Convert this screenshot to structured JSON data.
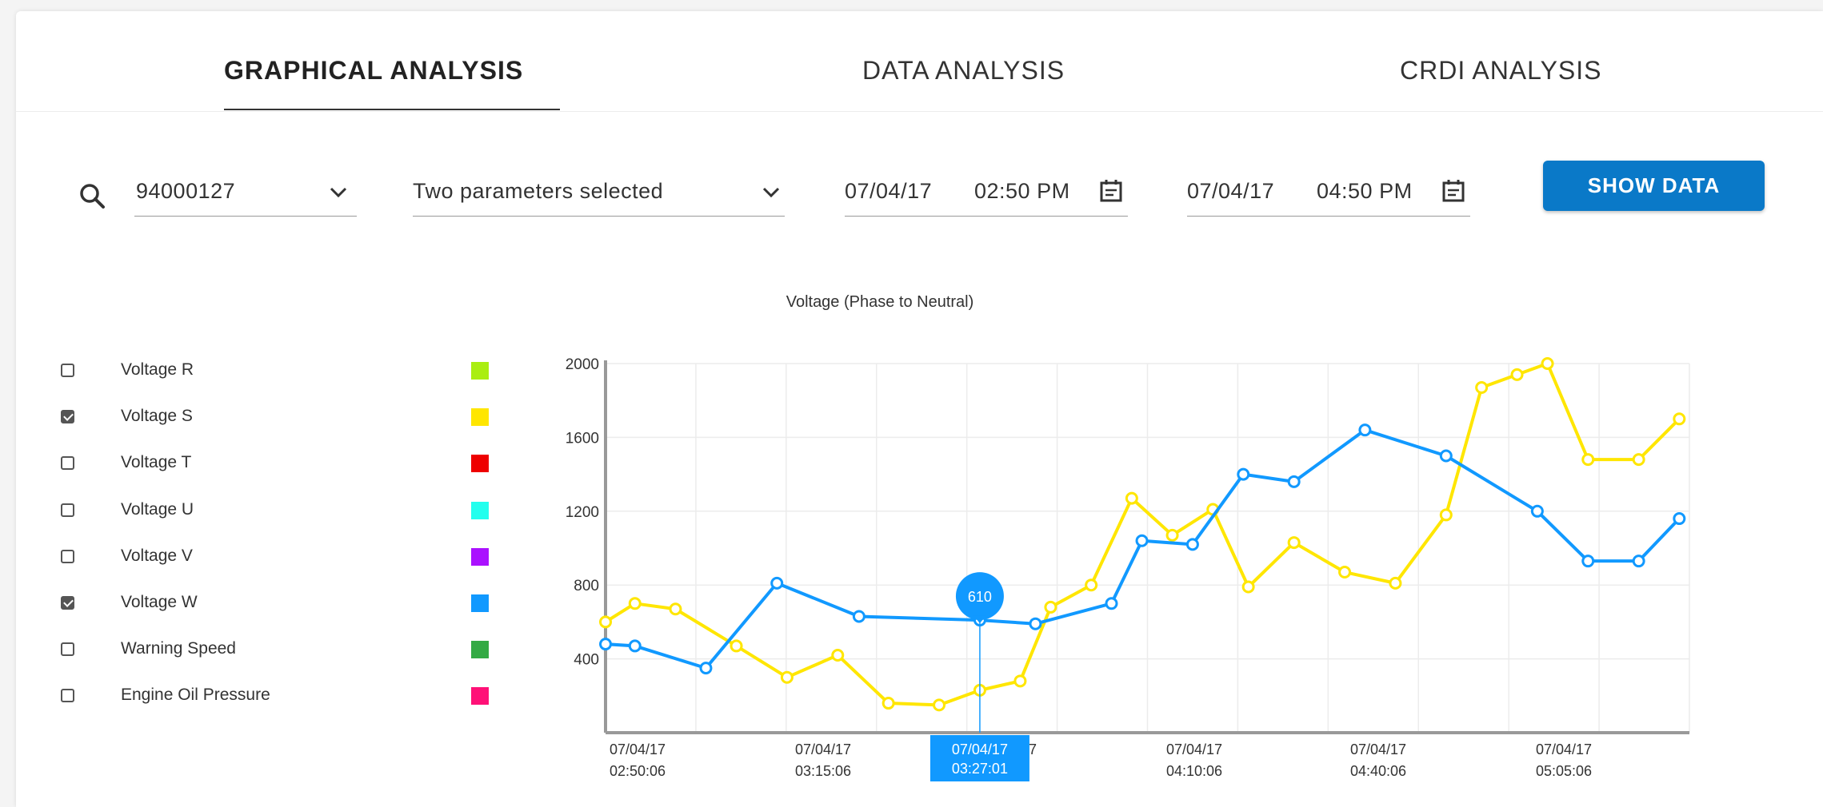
{
  "tabs": [
    {
      "label": "GRAPHICAL ANALYSIS",
      "active": true
    },
    {
      "label": "DATA ANALYSIS",
      "active": false
    },
    {
      "label": "CRDI ANALYSIS",
      "active": false
    }
  ],
  "controls": {
    "vehicle_id": "94000127",
    "parameters": "Two parameters selected",
    "start_date": "07/04/17",
    "start_time": "02:50 PM",
    "end_date": "07/04/17",
    "end_time": "04:50 PM",
    "show_button": "SHOW DATA"
  },
  "legend": [
    {
      "label": "Voltage R",
      "checked": false,
      "color": "#aaee11"
    },
    {
      "label": "Voltage S",
      "checked": true,
      "color": "#ffe600"
    },
    {
      "label": "Voltage T",
      "checked": false,
      "color": "#ee0000"
    },
    {
      "label": "Voltage U",
      "checked": false,
      "color": "#22ffee"
    },
    {
      "label": "Voltage V",
      "checked": false,
      "color": "#aa11ff"
    },
    {
      "label": "Voltage W",
      "checked": true,
      "color": "#1199ff"
    },
    {
      "label": "Warning Speed",
      "checked": false,
      "color": "#33aa44"
    },
    {
      "label": "Engine Oil Pressure",
      "checked": false,
      "color": "#ff1177"
    }
  ],
  "chart_data": {
    "type": "line",
    "title": "Voltage (Phase to Neutral)",
    "y_ticks": [
      "400",
      "800",
      "1200",
      "1600",
      "2000"
    ],
    "x_tick_labels": [
      {
        "date": "07/04/17",
        "time": "02:50:06"
      },
      {
        "date": "07/04/17",
        "time": "03:15:06"
      },
      {
        "date": "07/04/17",
        "time": "3:40:06"
      },
      {
        "date": "07/04/17",
        "time": "04:10:06"
      },
      {
        "date": "07/04/17",
        "time": "04:40:06"
      },
      {
        "date": "07/04/17",
        "time": "05:05:06"
      }
    ],
    "ylim": [
      0,
      2000
    ],
    "grid": true,
    "series": [
      {
        "name": "Voltage S",
        "color": "#ffe600",
        "points": [
          {
            "x": "02:50:06",
            "y": 600
          },
          {
            "x": "02:53:00",
            "y": 700
          },
          {
            "x": "02:57:00",
            "y": 670
          },
          {
            "x": "03:03:00",
            "y": 470
          },
          {
            "x": "03:08:00",
            "y": 300
          },
          {
            "x": "03:13:00",
            "y": 420
          },
          {
            "x": "03:18:00",
            "y": 160
          },
          {
            "x": "03:23:00",
            "y": 150
          },
          {
            "x": "03:27:01",
            "y": 230
          },
          {
            "x": "03:31:00",
            "y": 280
          },
          {
            "x": "03:34:00",
            "y": 680
          },
          {
            "x": "03:38:00",
            "y": 800
          },
          {
            "x": "03:42:00",
            "y": 1270
          },
          {
            "x": "03:46:00",
            "y": 1070
          },
          {
            "x": "03:50:00",
            "y": 1210
          },
          {
            "x": "03:53:30",
            "y": 790
          },
          {
            "x": "03:58:00",
            "y": 1030
          },
          {
            "x": "04:03:00",
            "y": 870
          },
          {
            "x": "04:08:00",
            "y": 810
          },
          {
            "x": "04:13:00",
            "y": 1180
          },
          {
            "x": "04:16:30",
            "y": 1870
          },
          {
            "x": "04:20:00",
            "y": 1940
          },
          {
            "x": "04:23:00",
            "y": 2000
          },
          {
            "x": "04:27:00",
            "y": 1480
          },
          {
            "x": "04:32:00",
            "y": 1480
          },
          {
            "x": "04:36:00",
            "y": 1700
          }
        ]
      },
      {
        "name": "Voltage W",
        "color": "#1199ff",
        "points": [
          {
            "x": "02:50:06",
            "y": 480
          },
          {
            "x": "02:53:00",
            "y": 470
          },
          {
            "x": "03:00:00",
            "y": 350
          },
          {
            "x": "03:07:00",
            "y": 810
          },
          {
            "x": "03:15:06",
            "y": 630
          },
          {
            "x": "03:27:01",
            "y": 610
          },
          {
            "x": "03:32:30",
            "y": 590
          },
          {
            "x": "03:40:00",
            "y": 700
          },
          {
            "x": "03:43:00",
            "y": 1040
          },
          {
            "x": "03:48:00",
            "y": 1020
          },
          {
            "x": "03:53:00",
            "y": 1400
          },
          {
            "x": "03:58:00",
            "y": 1360
          },
          {
            "x": "04:05:00",
            "y": 1640
          },
          {
            "x": "04:13:00",
            "y": 1500
          },
          {
            "x": "04:22:00",
            "y": 1200
          },
          {
            "x": "04:27:00",
            "y": 930
          },
          {
            "x": "04:32:00",
            "y": 930
          },
          {
            "x": "04:36:00",
            "y": 1160
          }
        ]
      }
    ],
    "highlight": {
      "value": "610",
      "date": "07/04/17",
      "time": "03:27:01"
    }
  }
}
